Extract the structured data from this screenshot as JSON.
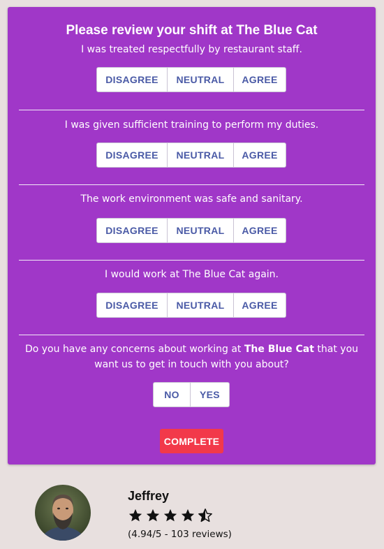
{
  "survey": {
    "title": "Please review your shift at The Blue Cat",
    "questions": [
      {
        "text": "I was treated respectfully by restaurant staff.",
        "options": [
          "DISAGREE",
          "NEUTRAL",
          "AGREE"
        ]
      },
      {
        "text": "I was given sufficient training to perform my duties.",
        "options": [
          "DISAGREE",
          "NEUTRAL",
          "AGREE"
        ]
      },
      {
        "text": "The work environment was safe and sanitary.",
        "options": [
          "DISAGREE",
          "NEUTRAL",
          "AGREE"
        ]
      },
      {
        "text": "I would work at The Blue Cat again.",
        "options": [
          "DISAGREE",
          "NEUTRAL",
          "AGREE"
        ]
      }
    ],
    "concern": {
      "text_before": "Do you have any concerns about working at ",
      "text_bold": "The Blue Cat",
      "text_after": " that you want us to get in touch with you about?",
      "options": [
        "NO",
        "YES"
      ]
    },
    "complete_label": "COMPLETE"
  },
  "profile": {
    "name": "Jeffrey",
    "rating": 4.5,
    "rating_max": 5,
    "reviews_text": "(4.94/5 - 103 reviews)"
  },
  "colors": {
    "card_bg": "#a037c8",
    "button_text": "#4a5aa6",
    "complete_bg": "#f2394a",
    "page_bg": "#e8e0df"
  }
}
